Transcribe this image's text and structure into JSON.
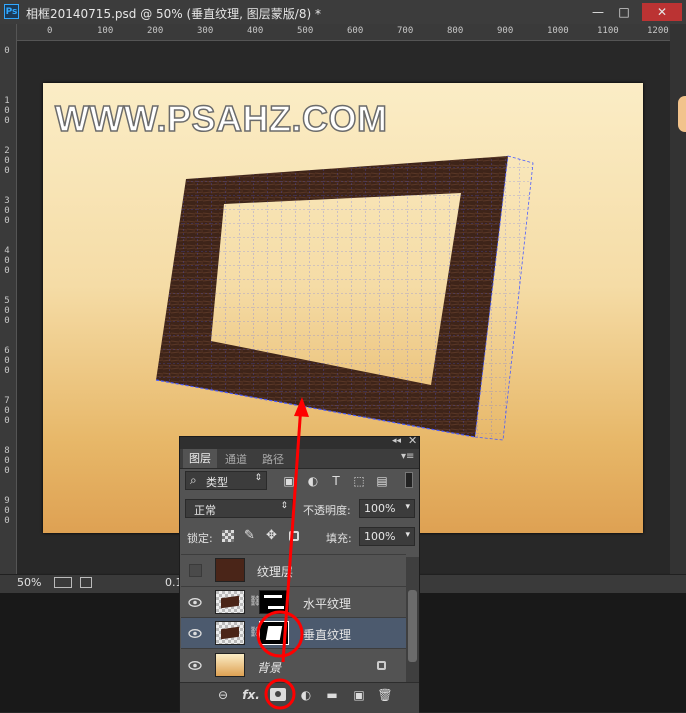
{
  "window": {
    "app_badge": "Ps",
    "title": "相框20140715.psd @ 50% (垂直纹理, 图层蒙版/8) *",
    "minimize_glyph": "—",
    "maximize_glyph": "□",
    "close_glyph": "✕"
  },
  "ruler": {
    "top_ticks": [
      "0",
      "100",
      "200",
      "300",
      "400",
      "500",
      "600",
      "700",
      "800",
      "900",
      "1000",
      "1100",
      "1200"
    ],
    "left_ticks": [
      "0",
      "100",
      "200",
      "300",
      "400",
      "500",
      "600",
      "700",
      "800",
      "900"
    ]
  },
  "canvas": {
    "watermark": "WWW.PSAHZ.COM",
    "bg_top": "#fbedc6",
    "bg_bottom": "#dea153",
    "frame_color": "#3e2419",
    "grid_color": "#4a5cff",
    "arrow_color": "#ff0000"
  },
  "status": {
    "zoom": "50%",
    "doc_info": "0.1"
  },
  "layers_panel": {
    "collapse_glyph": "◂◂",
    "close_glyph": "✕",
    "tabs": [
      "图层",
      "通道",
      "路径"
    ],
    "menu_glyph": "▾≡",
    "filter": {
      "search_glyph": "⌕",
      "label": "类型"
    },
    "blend_mode": "正常",
    "opacity_label": "不透明度:",
    "opacity_value": "100%",
    "lock_label": "锁定:",
    "fill_label": "填充:",
    "fill_value": "100%",
    "layers": [
      {
        "name": "纹理层",
        "visible": false
      },
      {
        "name": "水平纹理",
        "visible": true
      },
      {
        "name": "垂直纹理",
        "visible": true,
        "selected": true
      },
      {
        "name": "背景",
        "visible": true,
        "locked": true
      }
    ],
    "bottom_icons": [
      "link-icon",
      "fx-icon",
      "add-mask-icon",
      "adjustment-icon",
      "group-icon",
      "new-layer-icon",
      "trash-icon"
    ],
    "fx_label": "fx."
  },
  "annotation": {
    "highlight_color": "#ff0000"
  }
}
